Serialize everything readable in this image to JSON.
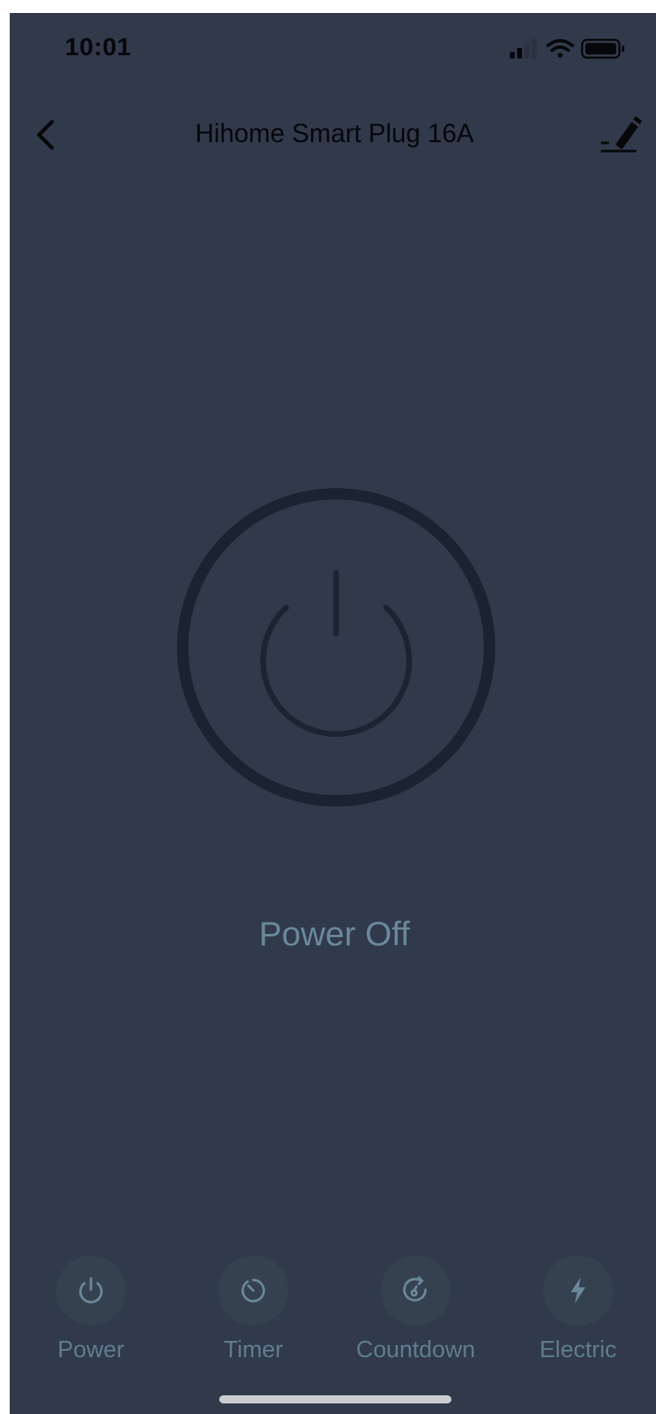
{
  "status_bar": {
    "time": "10:01",
    "icons": [
      "signal-icon",
      "wifi-icon",
      "battery-icon"
    ]
  },
  "nav": {
    "title": "Hihome Smart Plug 16A",
    "back_icon": "chevron-left-icon",
    "edit_icon": "edit-pencil-icon"
  },
  "device": {
    "power_state_label": "Power Off",
    "power_icon": "power-icon"
  },
  "tabs": [
    {
      "label": "Power",
      "icon": "power-icon"
    },
    {
      "label": "Timer",
      "icon": "timer-icon"
    },
    {
      "label": "Countdown",
      "icon": "countdown-icon"
    },
    {
      "label": "Electric",
      "icon": "lightning-icon"
    }
  ],
  "colors": {
    "background": "#313a4a",
    "accent_text": "#6a889b",
    "ring": "#1b2230"
  }
}
